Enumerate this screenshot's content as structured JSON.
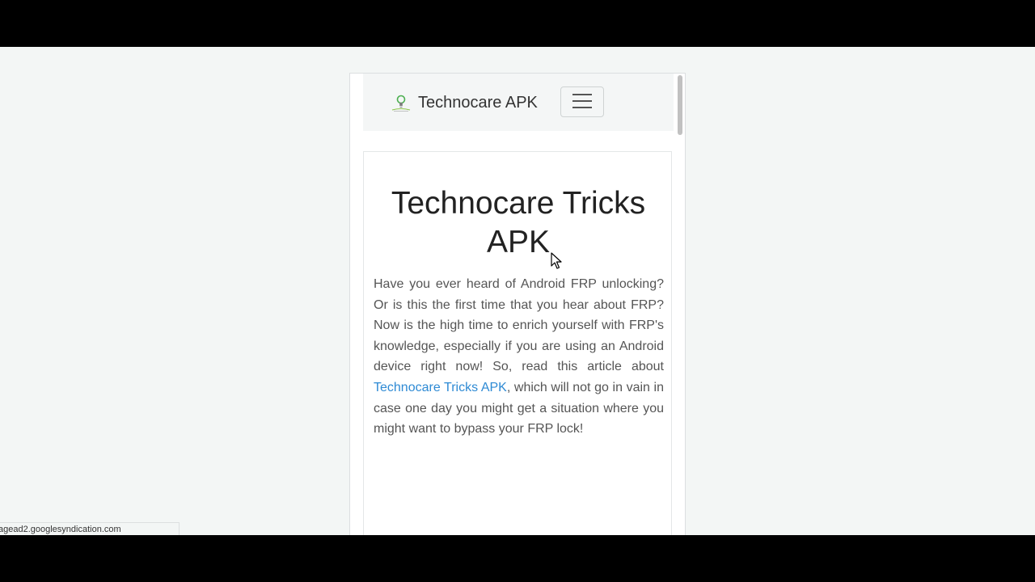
{
  "navbar": {
    "brand_name": "Technocare APK",
    "logo_icon": "lightbulb-logo-icon",
    "menu_icon": "hamburger-menu-icon"
  },
  "article": {
    "title": "Technocare Tricks APK",
    "body_before_link": "Have you ever heard of Android FRP unlocking? Or is this the first time that you hear about FRP? Now is the high time to enrich yourself with FRP's knowledge, especially if you are using an Android device right now! So, read this article about ",
    "link_text": "Technocare Tricks APK",
    "body_after_link": ", which will not go in vain in case one day you might get a situation where you might want to bypass your FRP lock!"
  },
  "status_bar": {
    "url": "agead2.googlesyndication.com"
  },
  "colors": {
    "link": "#2e8ad4",
    "page_background": "#f3f6f5",
    "navbar_background": "#f4f6f6",
    "text": "#555555"
  }
}
